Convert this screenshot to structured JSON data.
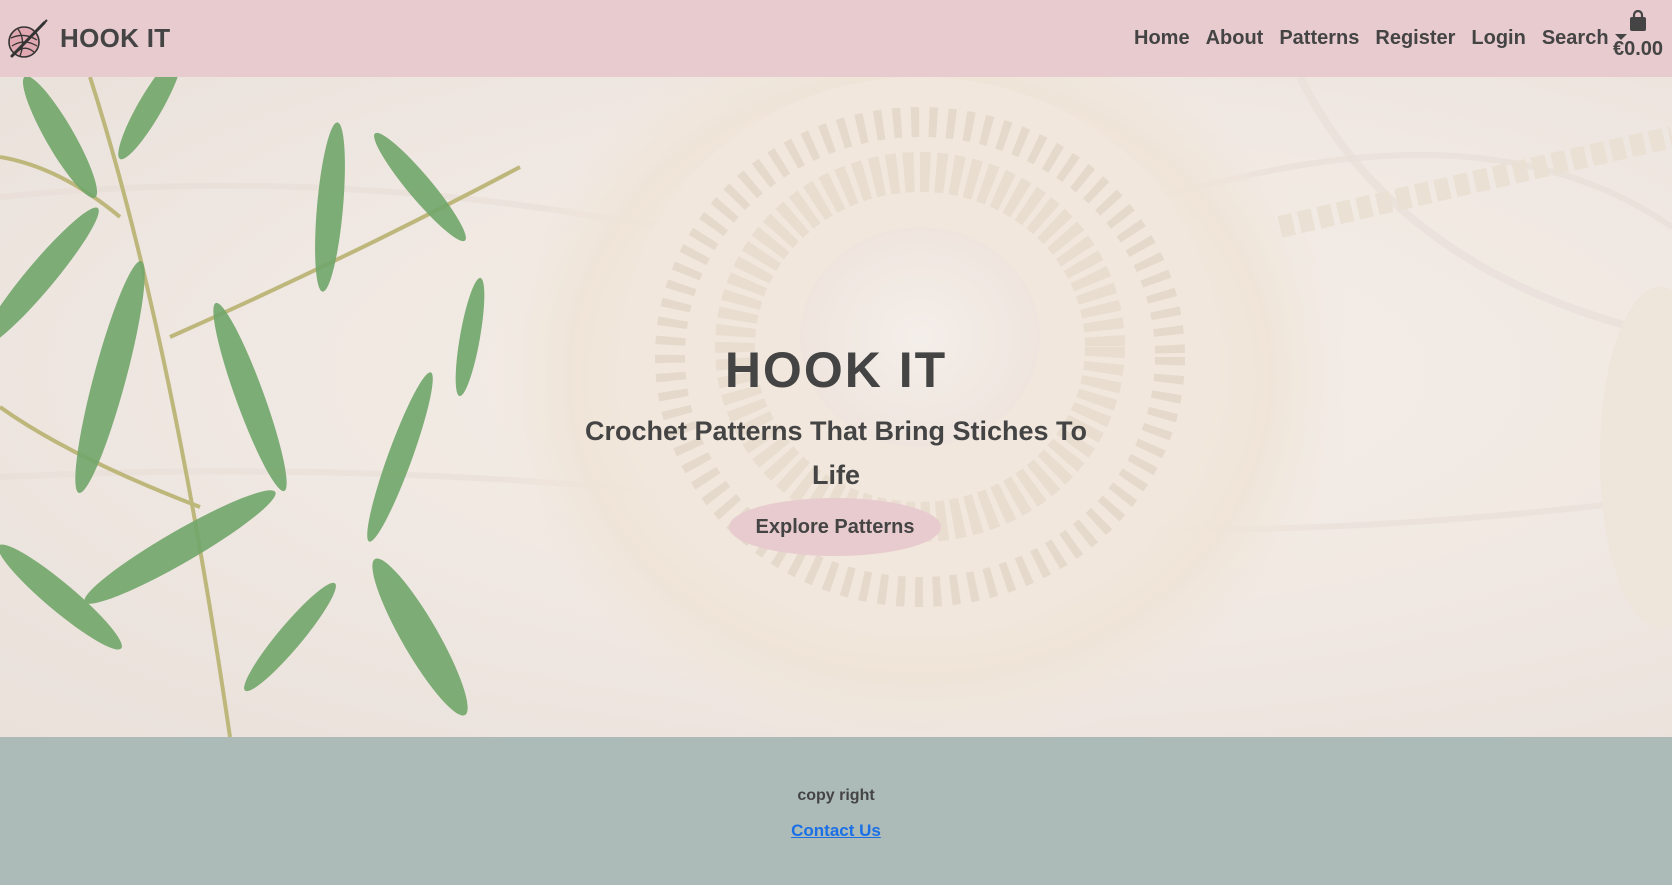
{
  "header": {
    "brand": "HOOK IT",
    "logo_icon": "yarn-ball-hook-icon",
    "nav": [
      "Home",
      "About",
      "Patterns",
      "Register",
      "Login"
    ],
    "search_label": "Search",
    "cart_icon": "shopping-bag-icon",
    "cart_total": "€0.00"
  },
  "hero": {
    "title": "HOOK IT",
    "subtitle": "Crochet Patterns That Bring Stiches To Life",
    "cta": "Explore Patterns"
  },
  "footer": {
    "copyright": "copy right",
    "contact": "Contact Us"
  },
  "colors": {
    "navbar": "#e8cbce",
    "footer": "#adbbb8",
    "text": "#444444",
    "link": "#1a6fe6"
  }
}
